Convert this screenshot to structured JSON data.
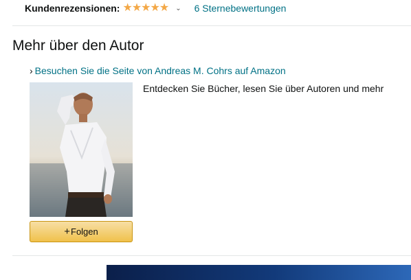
{
  "reviews": {
    "label": "Kundenrezensionen:",
    "stars": [
      "★",
      "★",
      "★",
      "★",
      "★"
    ],
    "rating_fraction": 1.0,
    "chevron": "⌄",
    "count_text": "6 Sternebewertungen"
  },
  "author_section": {
    "title": "Mehr über den Autor",
    "link_arrow": "›",
    "link_text": "Besuchen Sie die Seite von Andreas M. Cohrs auf Amazon",
    "description": "Entdecken Sie Bücher, lesen Sie über Autoren und mehr",
    "follow_plus": "+",
    "follow_label": "Folgen"
  },
  "colors": {
    "link": "#007185",
    "star": "#f3a847",
    "button": "#f0c14b"
  }
}
